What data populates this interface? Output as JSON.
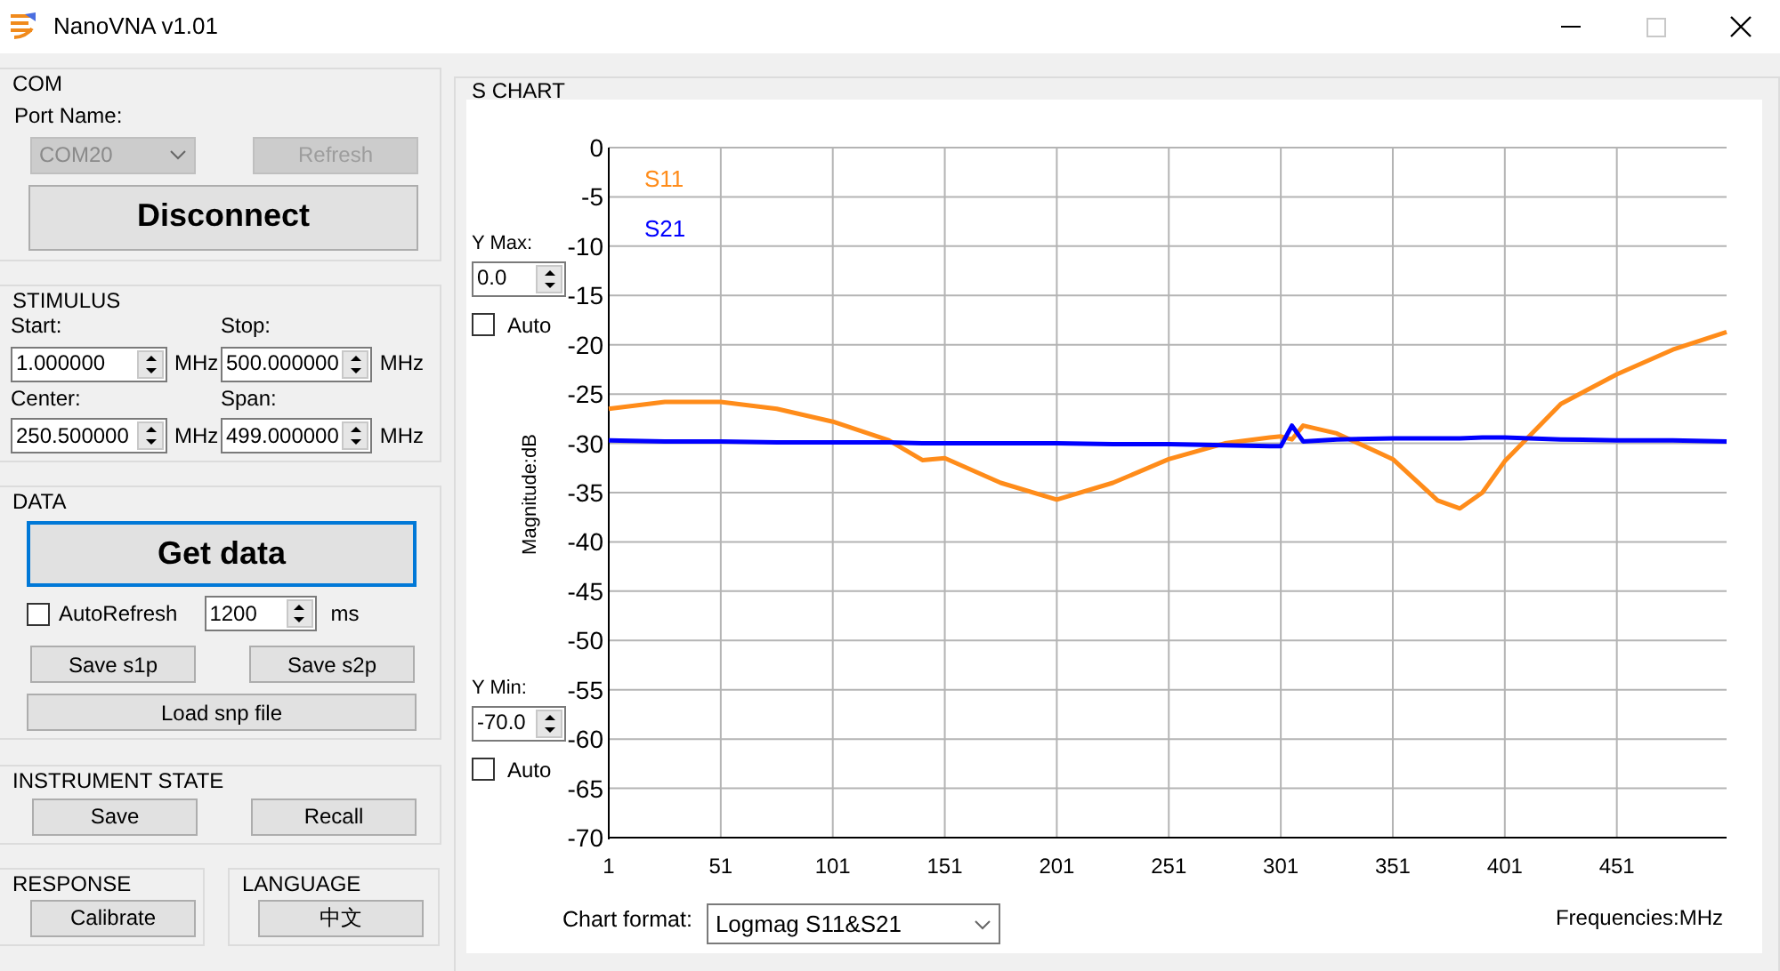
{
  "window": {
    "title": "NanoVNA v1.01",
    "maximize_disabled": true
  },
  "com": {
    "title": "COM",
    "port_label": "Port Name:",
    "port": {
      "value": "COM20",
      "disabled": true
    },
    "refresh": {
      "label": "Refresh",
      "disabled": true
    },
    "connect_button": "Disconnect"
  },
  "stimulus": {
    "title": "STIMULUS",
    "fields": [
      {
        "label": "Start:",
        "value": "1.000000",
        "unit": "MHz"
      },
      {
        "label": "Stop:",
        "value": "500.000000",
        "unit": "MHz"
      },
      {
        "label": "Center:",
        "value": "250.500000",
        "unit": "MHz"
      },
      {
        "label": "Span:",
        "value": "499.000000",
        "unit": "MHz"
      }
    ]
  },
  "data": {
    "title": "DATA",
    "get_button": {
      "label": "Get data",
      "focused": true
    },
    "auto_refresh": {
      "label": "AutoRefresh",
      "checked": false
    },
    "interval": {
      "value": "1200",
      "unit": "ms"
    },
    "save_buttons": [
      "Save s1p",
      "Save s2p"
    ],
    "load_button": "Load snp file"
  },
  "instrument_state": {
    "title": "INSTRUMENT STATE",
    "buttons": [
      "Save",
      "Recall"
    ]
  },
  "response": {
    "title": "RESPONSE",
    "button": "Calibrate"
  },
  "language": {
    "title": "LANGUAGE",
    "button": "中文"
  },
  "chart_panel": {
    "title": "S CHART",
    "y_max": {
      "label": "Y Max:",
      "value": "0.0",
      "auto_label": "Auto",
      "auto": false
    },
    "y_min": {
      "label": "Y Min:",
      "value": "-70.0",
      "auto_label": "Auto",
      "auto": false
    },
    "chart_format": {
      "label": "Chart format:",
      "value": "Logmag S11&S21"
    },
    "chart_data": {
      "type": "line",
      "grid": true,
      "xlabel": "Frequencies:MHz",
      "ylabel": "Magnitude:dB",
      "x": [
        1,
        26,
        51,
        76,
        101,
        126,
        141,
        151,
        176,
        201,
        226,
        251,
        276,
        296,
        301,
        306,
        311,
        326,
        351,
        371,
        381,
        391,
        401,
        426,
        451,
        476,
        500
      ],
      "series": [
        {
          "name": "S11",
          "color": "#ff8c1a",
          "values": [
            -26.5,
            -25.8,
            -25.8,
            -26.5,
            -27.8,
            -29.7,
            -31.7,
            -31.5,
            -34,
            -35.7,
            -34,
            -31.6,
            -30,
            -29.4,
            -29.3,
            -29.6,
            -28.2,
            -29,
            -31.6,
            -35.8,
            -36.6,
            -35,
            -31.8,
            -26,
            -23,
            -20.5,
            -18.7
          ]
        },
        {
          "name": "S21",
          "color": "#0000ff",
          "values": [
            -29.7,
            -29.8,
            -29.8,
            -29.9,
            -29.9,
            -29.9,
            -30,
            -30,
            -30,
            -30,
            -30.1,
            -30.1,
            -30.2,
            -30.3,
            -30.3,
            -28.2,
            -29.8,
            -29.6,
            -29.5,
            -29.5,
            -29.5,
            -29.4,
            -29.4,
            -29.6,
            -29.7,
            -29.7,
            -29.8
          ]
        }
      ],
      "xlim": [
        1,
        500
      ],
      "ylim": [
        -70,
        0
      ],
      "xticks": [
        1,
        51,
        101,
        151,
        201,
        251,
        301,
        351,
        401,
        451
      ],
      "yticks": [
        0,
        -5,
        -10,
        -15,
        -20,
        -25,
        -30,
        -35,
        -40,
        -45,
        -50,
        -55,
        -60,
        -65,
        -70
      ]
    }
  }
}
